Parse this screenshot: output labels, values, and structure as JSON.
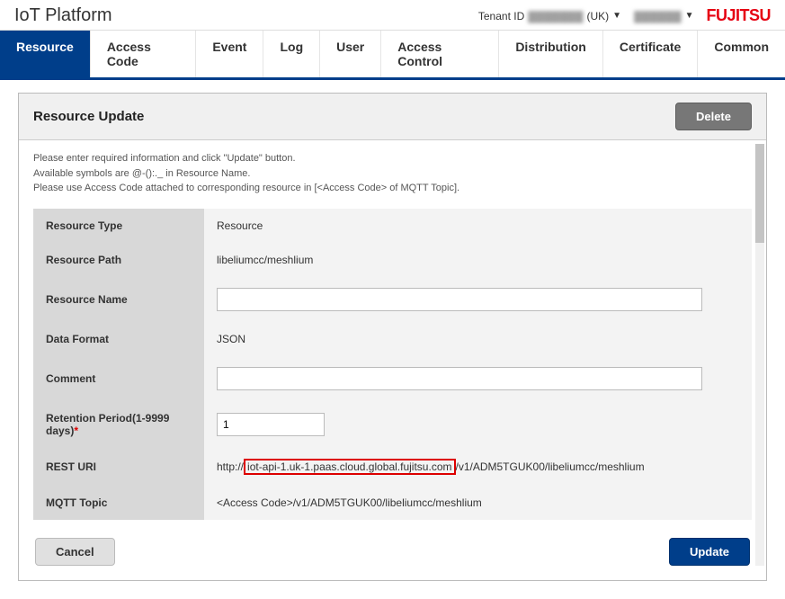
{
  "header": {
    "logo": "IoT Platform",
    "tenant_label": "Tenant ID",
    "tenant_blur": "▓▓▓▓▓▓▓",
    "tenant_region": "(UK)",
    "user_blur": "▓▓▓▓▓▓",
    "brand": "FUJITSU"
  },
  "tabs": [
    "Resource",
    "Access Code",
    "Event",
    "Log",
    "User",
    "Access Control",
    "Distribution",
    "Certificate",
    "Common"
  ],
  "panel": {
    "title": "Resource Update",
    "delete_label": "Delete",
    "instructions_l1": "Please enter required information and click \"Update\" button.",
    "instructions_l2": "Available symbols are @-():._ in Resource Name.",
    "instructions_l3": "Please use Access Code attached to corresponding resource in [<Access Code> of MQTT Topic]."
  },
  "fields": {
    "resource_type_label": "Resource Type",
    "resource_type_value": "Resource",
    "resource_path_label": "Resource Path",
    "resource_path_value": "libeliumcc/meshlium",
    "resource_name_label": "Resource Name",
    "resource_name_value": "",
    "data_format_label": "Data Format",
    "data_format_value": "JSON",
    "comment_label": "Comment",
    "comment_value": "",
    "retention_label": "Retention Period(1-9999 days)",
    "retention_value": "1",
    "rest_uri_label": "REST URI",
    "rest_uri_prefix": "http://",
    "rest_uri_host": "iot-api-1.uk-1.paas.cloud.global.fujitsu.com",
    "rest_uri_suffix": "/v1/ADM5TGUK00/libeliumcc/meshlium",
    "mqtt_label": "MQTT Topic",
    "mqtt_value": "<Access Code>/v1/ADM5TGUK00/libeliumcc/meshlium"
  },
  "buttons": {
    "cancel": "Cancel",
    "update": "Update"
  }
}
